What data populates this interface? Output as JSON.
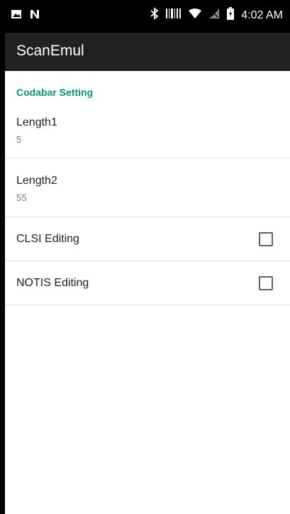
{
  "status_bar": {
    "time": "4:02 AM",
    "icons": [
      "image-icon",
      "n-icon",
      "bluetooth-icon",
      "barcode-icon",
      "wifi-icon",
      "signal-icon",
      "battery-icon"
    ]
  },
  "app_bar": {
    "title": "ScanEmul"
  },
  "settings": {
    "section_title": "Codabar Setting",
    "items": [
      {
        "title": "Length1",
        "summary": "5"
      },
      {
        "title": "Length2",
        "summary": "55"
      },
      {
        "title": "CLSI Editing",
        "checked": false
      },
      {
        "title": "NOTIS Editing",
        "checked": false
      }
    ]
  },
  "colors": {
    "accent": "#009688",
    "app_bar": "#212121",
    "status_bar": "#000000"
  }
}
